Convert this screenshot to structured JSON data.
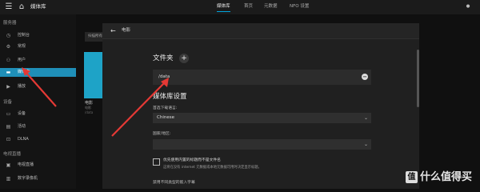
{
  "topbar": {
    "title": "媒体库",
    "nav": [
      {
        "label": "媒体库",
        "active": true
      },
      {
        "label": "首页",
        "active": false
      },
      {
        "label": "元数据",
        "active": false
      },
      {
        "label": "NFO 设置",
        "active": false
      }
    ],
    "icons": {
      "menu": "menu-icon",
      "home": "home-icon",
      "user": "user-icon"
    }
  },
  "sidebar": {
    "sections": [
      {
        "heading": "服务器",
        "items": [
          {
            "label": "控制台",
            "icon": "dashboard-icon",
            "active": false
          },
          {
            "label": "常规",
            "icon": "settings-icon",
            "active": false
          },
          {
            "label": "用户",
            "icon": "users-icon",
            "active": false
          },
          {
            "label": "媒体库",
            "icon": "folder-icon",
            "active": true
          },
          {
            "label": "播放",
            "icon": "play-icon",
            "active": false
          }
        ]
      },
      {
        "heading": "设备",
        "items": [
          {
            "label": "设备",
            "icon": "devices-icon",
            "active": false
          },
          {
            "label": "活动",
            "icon": "activity-icon",
            "active": false
          },
          {
            "label": "DLNA",
            "icon": "dlna-icon",
            "active": false
          }
        ]
      },
      {
        "heading": "电视直播",
        "items": [
          {
            "label": "电视直播",
            "icon": "tv-icon",
            "active": false
          },
          {
            "label": "数字录像机",
            "icon": "dvr-icon",
            "active": false
          }
        ]
      }
    ]
  },
  "background": {
    "toolbar_button": "扫描所有媒体库",
    "card_title": "电影",
    "card_sub": "电影",
    "card_sub2": "/data",
    "accent": "#1ea3c7"
  },
  "dialog": {
    "title": "电影",
    "folders_title": "文件夹",
    "folders": [
      "/data"
    ],
    "settings_title": "媒体库设置",
    "language_label": "首选下载语言:",
    "language_value": "Chinese",
    "country_label": "国家/地区:",
    "country_value": "",
    "checkbox_label": "优先使用内置的标题而不是文件名",
    "checkbox_help": "这将在没有 internet 元数据或本地元数据可用时决定显示标题。",
    "checkbox_checked": false,
    "bottom_label": "禁用不同类型的嵌入字幕"
  },
  "watermark": {
    "logo": "值",
    "text": "什么值得买"
  },
  "colors": {
    "accent": "#00a4dc",
    "active_sidebar": "#1f8fb8",
    "annotation_arrow": "#e53935"
  }
}
